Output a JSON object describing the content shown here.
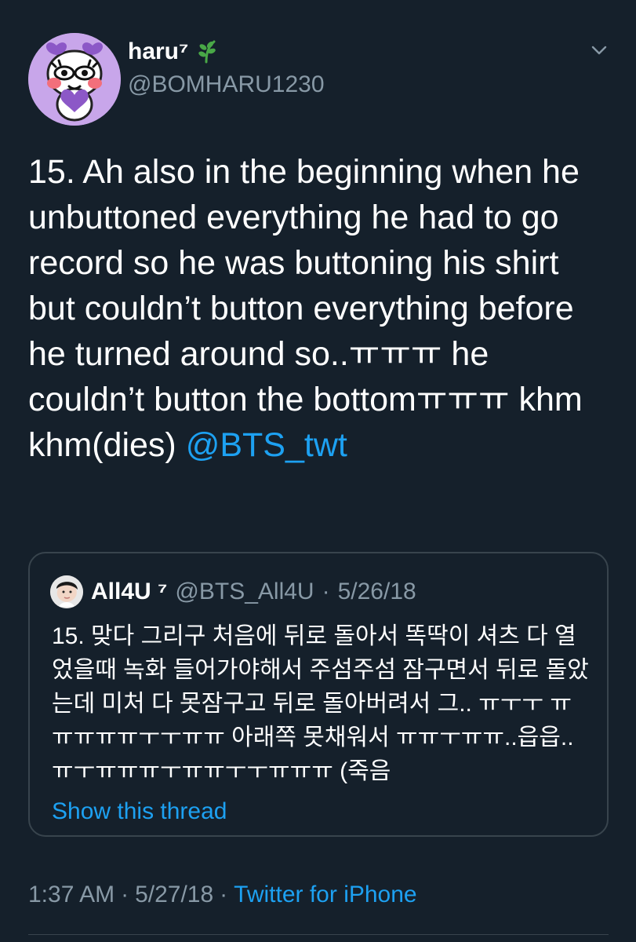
{
  "user": {
    "display_name": "haru⁷",
    "handle": "@BOMHARU1230",
    "avatar_icon": "cute-character-avatar-icon",
    "name_icon": "leaf-icon"
  },
  "tweet": {
    "text_main": "15. Ah also in the beginning when he unbuttoned everything he had to go record so he was buttoning his shirt but couldn’t button everything before he turned around so..ㅠㅠㅠ he couldn’t button the bottomㅠㅠㅠ khm khm(dies) ",
    "mention": "@BTS_twt"
  },
  "quote": {
    "display_name": "All4U ⁷",
    "handle": "@BTS_All4U",
    "dot": "·",
    "date": "5/26/18",
    "text": "15. 맞다 그리구 처음에 뒤로 돌아서 똑딱이 셔츠 다 열었을때 녹화 들어가야해서 주섬주섬 잠구면서 뒤로 돌았는데 미처 다 못잠구고 뒤로 돌아버려서 그.. ㅠㅜㅜ ㅠㅠㅠㅠㅠㅜㅜㅠㅠ 아래쪽 못채워서 ㅠㅠㅜㅠㅠ..읍읍.. ㅠㅜㅠㅠㅠㅜㅠㅠㅜㅜㅠㅠㅠ (죽음",
    "show_thread": "Show this thread"
  },
  "meta": {
    "time": "1:37 AM",
    "dot1": "·",
    "date": "5/27/18",
    "dot2": "·",
    "source": "Twitter for iPhone"
  },
  "colors": {
    "background": "#15202b",
    "text": "#ffffff",
    "muted": "#8899a6",
    "accent": "#1da1f2",
    "border": "#38444d"
  }
}
